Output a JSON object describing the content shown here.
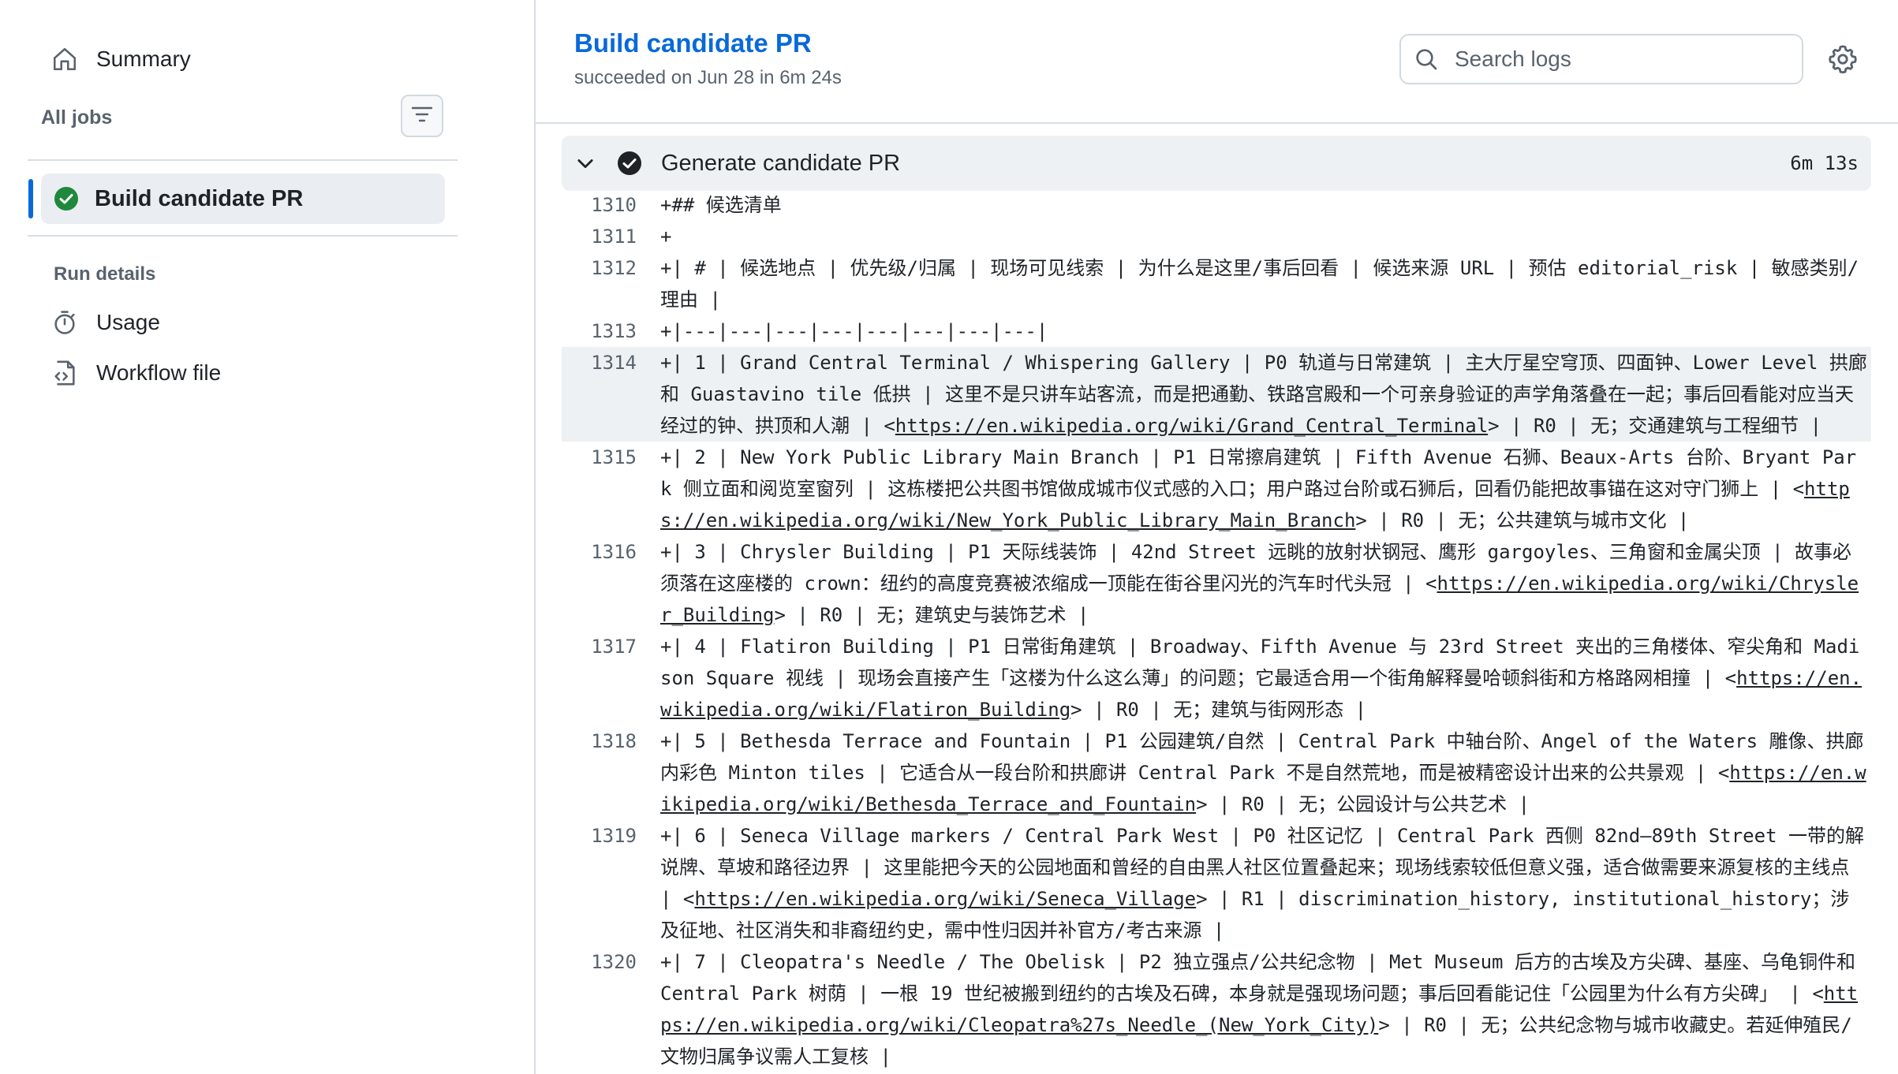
{
  "sidebar": {
    "summary_label": "Summary",
    "all_jobs_label": "All jobs",
    "selected_job_label": "Build candidate PR",
    "run_details_label": "Run details",
    "usage_label": "Usage",
    "workflow_file_label": "Workflow file"
  },
  "header": {
    "title": "Build candidate PR",
    "subtitle": "succeeded on Jun 28 in 6m 24s",
    "search_placeholder": "Search logs"
  },
  "step": {
    "name": "Generate candidate PR",
    "duration": "6m 13s"
  },
  "log_lines": [
    {
      "n": "1310",
      "pre": "+## 候选清单",
      "url": "",
      "post": ""
    },
    {
      "n": "1311",
      "pre": "+",
      "url": "",
      "post": ""
    },
    {
      "n": "1312",
      "pre": "+| # | 候选地点 | 优先级/归属 | 现场可见线索 | 为什么是这里/事后回看 | 候选来源 URL | 预估 editorial_risk | 敏感类别/理由 |",
      "url": "",
      "post": ""
    },
    {
      "n": "1313",
      "pre": "+|---|---|---|---|---|---|---|---|",
      "url": "",
      "post": ""
    },
    {
      "n": "1314",
      "pre": "+| 1 | Grand Central Terminal / Whispering Gallery | P0 轨道与日常建筑 | 主大厅星空穹顶、四面钟、Lower Level 拱廊和 Guastavino tile 低拱 | 这里不是只讲车站客流，而是把通勤、铁路宫殿和一个可亲身验证的声学角落叠在一起；事后回看能对应当天经过的钟、拱顶和人潮 | <",
      "url": "https://en.wikipedia.org/wiki/Grand_Central_Terminal",
      "post": "> | R0 | 无；交通建筑与工程细节 |"
    },
    {
      "n": "1315",
      "pre": "+| 2 | New York Public Library Main Branch | P1 日常擦肩建筑 | Fifth Avenue 石狮、Beaux-Arts 台阶、Bryant Park 侧立面和阅览室窗列 | 这栋楼把公共图书馆做成城市仪式感的入口；用户路过台阶或石狮后，回看仍能把故事锚在这对守门狮上 | <",
      "url": "https://en.wikipedia.org/wiki/New_York_Public_Library_Main_Branch",
      "post": "> | R0 | 无；公共建筑与城市文化 |"
    },
    {
      "n": "1316",
      "pre": "+| 3 | Chrysler Building | P1 天际线装饰 | 42nd Street 远眺的放射状钢冠、鹰形 gargoyles、三角窗和金属尖顶 | 故事必须落在这座楼的 crown：纽约的高度竞赛被浓缩成一顶能在街谷里闪光的汽车时代头冠 | <",
      "url": "https://en.wikipedia.org/wiki/Chrysler_Building",
      "post": "> | R0 | 无；建筑史与装饰艺术 |"
    },
    {
      "n": "1317",
      "pre": "+| 4 | Flatiron Building | P1 日常街角建筑 | Broadway、Fifth Avenue 与 23rd Street 夹出的三角楼体、窄尖角和 Madison Square 视线 | 现场会直接产生「这楼为什么这么薄」的问题；它最适合用一个街角解释曼哈顿斜街和方格路网相撞 | <",
      "url": "https://en.wikipedia.org/wiki/Flatiron_Building",
      "post": "> | R0 | 无；建筑与街网形态 |"
    },
    {
      "n": "1318",
      "pre": "+| 5 | Bethesda Terrace and Fountain | P1 公园建筑/自然 | Central Park 中轴台阶、Angel of the Waters 雕像、拱廊内彩色 Minton tiles | 它适合从一段台阶和拱廊讲 Central Park 不是自然荒地，而是被精密设计出来的公共景观 | <",
      "url": "https://en.wikipedia.org/wiki/Bethesda_Terrace_and_Fountain",
      "post": "> | R0 | 无；公园设计与公共艺术 |"
    },
    {
      "n": "1319",
      "pre": "+| 6 | Seneca Village markers / Central Park West | P0 社区记忆 | Central Park 西侧 82nd–89th Street 一带的解说牌、草坡和路径边界 | 这里能把今天的公园地面和曾经的自由黑人社区位置叠起来；现场线索较低但意义强，适合做需要来源复核的主线点 | <",
      "url": "https://en.wikipedia.org/wiki/Seneca_Village",
      "post": "> | R1 | discrimination_history, institutional_history；涉及征地、社区消失和非裔纽约史，需中性归因并补官方/考古来源 |"
    },
    {
      "n": "1320",
      "pre": "+| 7 | Cleopatra's Needle / The Obelisk | P2 独立强点/公共纪念物 | Met Museum 后方的古埃及方尖碑、基座、乌龟铜件和 Central Park 树荫 | 一根 19 世纪被搬到纽约的古埃及石碑，本身就是强现场问题；事后回看能记住「公园里为什么有方尖碑」 | <",
      "url": "https://en.wikipedia.org/wiki/Cleopatra%27s_Needle_(New_York_City)",
      "post": "> | R0 | 无；公共纪念物与城市收藏史。若延伸殖民/文物归属争议需人工复核 |"
    }
  ]
}
